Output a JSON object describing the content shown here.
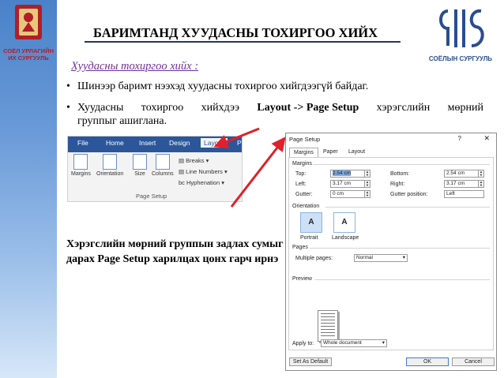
{
  "header": {
    "title": "БАРИМТАНД ХУУДАСНЫ ТОХИРГОО ХИЙХ",
    "left_logo_text": "СОЁЛ УРЛАГИЙН ИХ СУРГУУЛЬ",
    "right_logo_text": "СОЁЛЫН СУРГУУЛЬ"
  },
  "content": {
    "subtitle": "Хуудасны тохиргоо хийх :",
    "bullet1": "Шинээр баримт нээхэд хуудасны тохиргоо хийгдээгүй байдаг.",
    "bullet2": {
      "w1": "Хуудасны",
      "w2": "тохиргоо",
      "w3": "хийхдээ",
      "bold": "Layout -> Page Setup",
      "w4": "хэрэгслийн",
      "w5": "мөрний",
      "line2": "группыг ашиглана."
    },
    "note": "Хэрэгслийн мөрний группын задлах сумыг дарах Page Setup харилцах цонх гарч ирнэ"
  },
  "ribbon": {
    "tabs": [
      "File",
      "Home",
      "Insert",
      "Design",
      "Layout",
      "P"
    ],
    "buttons": [
      "Margins",
      "Orientation",
      "Size",
      "Columns"
    ],
    "small_items": [
      "Breaks",
      "Line Numbers",
      "Hyphenation"
    ],
    "group_label": "Page Setup"
  },
  "dialog": {
    "title": "Page Setup",
    "help": "?",
    "close": "✕",
    "tabs": [
      "Margins",
      "Paper",
      "Layout"
    ],
    "margins_label": "Margins",
    "top_label": "Top:",
    "top_value": "2.54 cm",
    "bottom_label": "Bottom:",
    "bottom_value": "2.54 cm",
    "left_label": "Left:",
    "left_value": "3.17 cm",
    "right_label": "Right:",
    "right_value": "3.17 cm",
    "gutter_label": "Gutter:",
    "gutter_value": "0 cm",
    "gutter_pos_label": "Gutter position:",
    "gutter_pos_value": "Left",
    "orientation_label": "Orientation",
    "portrait": "Portrait",
    "landscape": "Landscape",
    "pages_label": "Pages",
    "multiple_pages_label": "Multiple pages:",
    "multiple_pages_value": "Normal",
    "preview_label": "Preview",
    "apply_to_label": "Apply to:",
    "apply_to_value": "Whole document",
    "set_default": "Set As Default",
    "ok": "OK",
    "cancel": "Cancel"
  },
  "colors": {
    "accent_blue": "#2b579a",
    "subtitle_purple": "#7030a0",
    "arrow_red": "#e0202a"
  }
}
